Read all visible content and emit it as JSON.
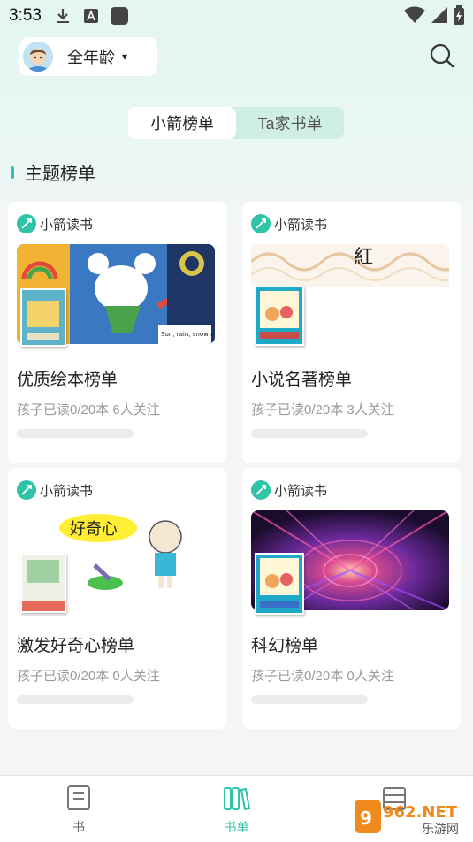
{
  "status_bar": {
    "time": "3:53",
    "icons": [
      "download-icon",
      "a-icon",
      "app-square-icon"
    ],
    "right_icons": [
      "wifi-icon",
      "signal-icon",
      "battery-icon"
    ]
  },
  "header": {
    "age_label": "全年龄",
    "caret": "▾"
  },
  "tabs": [
    {
      "label": "小箭榜单",
      "active": true
    },
    {
      "label": "Ta家书单",
      "active": false
    }
  ],
  "section": {
    "title": "主题榜单"
  },
  "cards": [
    {
      "brand": "小箭读书",
      "title": "优质绘本榜单",
      "stats": "孩子已读0/20本 6人关注",
      "progress": 0,
      "cover_text": "Sun, rain, snow and a"
    },
    {
      "brand": "小箭读书",
      "title": "小说名著榜单",
      "stats": "孩子已读0/20本 3人关注",
      "progress": 0,
      "cover_text": "紅"
    },
    {
      "brand": "小箭读书",
      "title": "激发好奇心榜单",
      "stats": "孩子已读0/20本 0人关注",
      "progress": 0,
      "cover_text": "好奇心"
    },
    {
      "brand": "小箭读书",
      "title": "科幻榜单",
      "stats": "孩子已读0/20本 0人关注",
      "progress": 0,
      "cover_text": ""
    }
  ],
  "bottom_nav": [
    {
      "label": "书",
      "icon": "book-icon",
      "active": false
    },
    {
      "label": "书单",
      "icon": "booklist-icon",
      "active": true
    },
    {
      "label": "",
      "icon": "library-icon",
      "active": false
    }
  ],
  "watermark": {
    "main": "962.NET",
    "sub": "乐游网"
  },
  "colors": {
    "accent": "#2fc3a8",
    "tab_bg": "#cfeee4",
    "muted_text": "#9a9a9a"
  }
}
